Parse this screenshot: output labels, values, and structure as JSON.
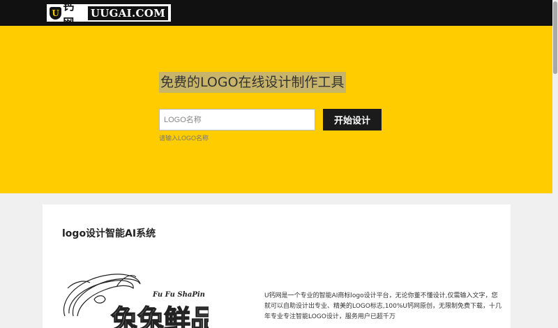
{
  "header": {
    "logo_cn": "钙网",
    "logo_en": "UUGAI.COM",
    "logo_mark": "U"
  },
  "hero": {
    "title": "免费的LOGO在线设计制作工具",
    "input_value": "",
    "input_placeholder": "LOGO名称",
    "button_label": "开始设计",
    "hint": "请输入LOGO名称"
  },
  "section": {
    "title": "logo设计智能AI系统",
    "description": "U钙网是一个专业的智能AI商标logo设计平台，无论你董不懂设计,仅需输入文字，您就可以自助设计出专业、精美的LOGO标志,100%U钙网原创，无限制免费下载，十几年专业专注智能LOGO设计，服务用户已超千万",
    "sample_small_text": "Fu Fu ShaPin",
    "sample_big_text": "兔兔鲜品"
  },
  "colors": {
    "brand_yellow": "#ffcc00",
    "header_black": "#111111",
    "button_black": "#1b1b1b"
  }
}
